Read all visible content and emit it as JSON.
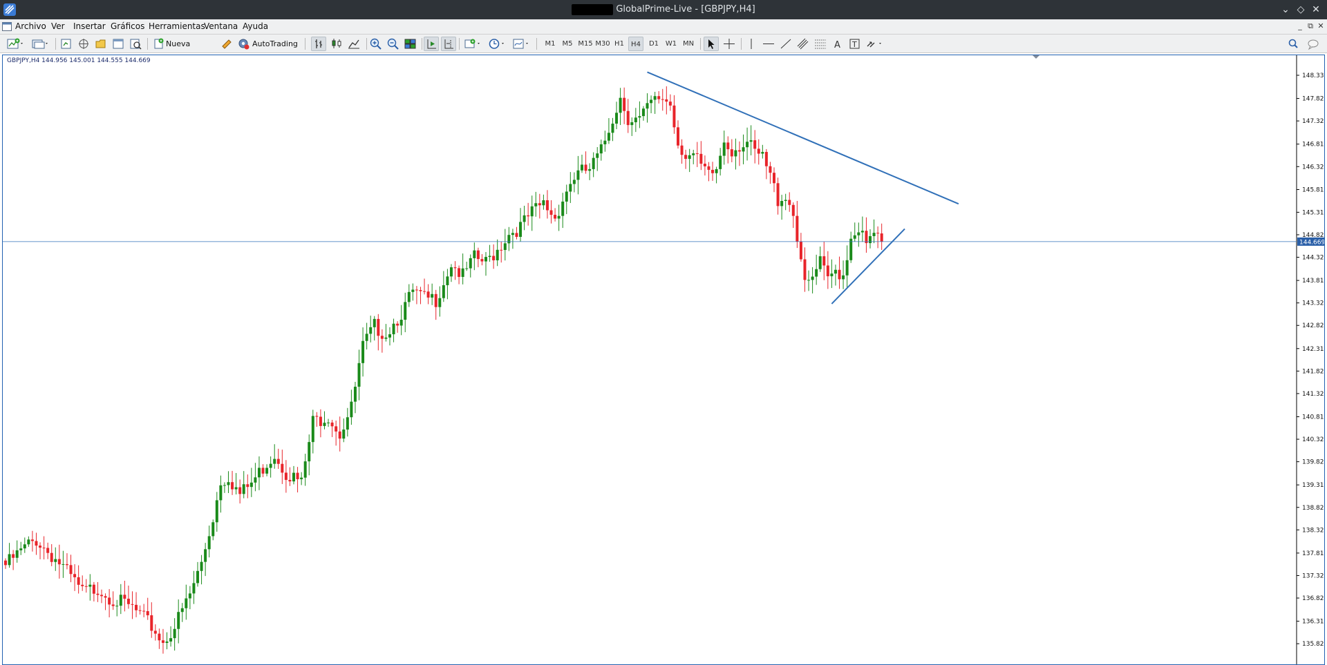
{
  "window": {
    "title": "GlobalPrime-Live - [GBPJPY,H4]",
    "controls": {
      "minimize": "⌄",
      "restore": "◇",
      "close": "✕"
    }
  },
  "menubar": {
    "items": [
      "Archivo",
      "Ver",
      "Insertar",
      "Gráficos",
      "Herramientas",
      "Ventana",
      "Ayuda"
    ],
    "mdi": {
      "minimize": "_",
      "restore": "⧉",
      "close": "✕"
    }
  },
  "toolbar": {
    "new_order_label": "Nueva orden",
    "autotrading_label": "AutoTrading",
    "timeframes": [
      "M1",
      "M5",
      "M15",
      "M30",
      "H1",
      "H4",
      "D1",
      "W1",
      "MN"
    ],
    "active_timeframe": "H4"
  },
  "chart_data": {
    "type": "candlestick",
    "symbol_info": "GBPJPY,H4  144.956 145.001 144.555 144.669",
    "last_price": "144.669",
    "price_axis": [
      "148.330",
      "147.820",
      "147.325",
      "146.815",
      "146.320",
      "145.815",
      "145.315",
      "144.820",
      "144.325",
      "143.815",
      "143.320",
      "142.825",
      "142.315",
      "141.820",
      "141.325",
      "140.815",
      "140.320",
      "139.825",
      "139.315",
      "138.820",
      "138.325",
      "137.815",
      "137.320",
      "136.825",
      "136.315",
      "135.820"
    ],
    "ylim": [
      135.45,
      148.6
    ],
    "colors": {
      "bull": "#1a8a1a",
      "bear": "#e8242a",
      "wick": "#333333",
      "trendline": "#3070b8",
      "price_line": "#3070b8",
      "price_tag_bg": "#2a5fa8"
    },
    "anchors": [
      {
        "i": 0,
        "p": 137.55
      },
      {
        "i": 6,
        "p": 138.0
      },
      {
        "i": 8,
        "p": 138.1
      },
      {
        "i": 14,
        "p": 137.6
      },
      {
        "i": 20,
        "p": 136.95
      },
      {
        "i": 24,
        "p": 137.05
      },
      {
        "i": 28,
        "p": 136.8
      },
      {
        "i": 33,
        "p": 136.6
      },
      {
        "i": 38,
        "p": 136.2
      },
      {
        "i": 41,
        "p": 135.85
      },
      {
        "i": 44,
        "p": 136.2
      },
      {
        "i": 48,
        "p": 136.9
      },
      {
        "i": 51,
        "p": 137.6
      },
      {
        "i": 54,
        "p": 138.6
      },
      {
        "i": 56,
        "p": 139.4
      },
      {
        "i": 58,
        "p": 139.5
      },
      {
        "i": 61,
        "p": 139.1
      },
      {
        "i": 64,
        "p": 139.35
      },
      {
        "i": 67,
        "p": 139.7
      },
      {
        "i": 70,
        "p": 140.0
      },
      {
        "i": 73,
        "p": 139.6
      },
      {
        "i": 77,
        "p": 139.35
      },
      {
        "i": 80,
        "p": 140.7
      },
      {
        "i": 84,
        "p": 140.85
      },
      {
        "i": 87,
        "p": 140.45
      },
      {
        "i": 90,
        "p": 141.0
      },
      {
        "i": 93,
        "p": 142.35
      },
      {
        "i": 96,
        "p": 142.8
      },
      {
        "i": 99,
        "p": 142.65
      },
      {
        "i": 103,
        "p": 143.1
      },
      {
        "i": 106,
        "p": 143.55
      },
      {
        "i": 109,
        "p": 143.4
      },
      {
        "i": 112,
        "p": 143.4
      },
      {
        "i": 116,
        "p": 144.2
      },
      {
        "i": 119,
        "p": 143.9
      },
      {
        "i": 122,
        "p": 144.3
      },
      {
        "i": 125,
        "p": 144.2
      },
      {
        "i": 128,
        "p": 144.5
      },
      {
        "i": 131,
        "p": 144.85
      },
      {
        "i": 134,
        "p": 145.0
      },
      {
        "i": 137,
        "p": 145.3
      },
      {
        "i": 140,
        "p": 145.5
      },
      {
        "i": 143,
        "p": 145.2
      },
      {
        "i": 146,
        "p": 145.8
      },
      {
        "i": 148,
        "p": 146.1
      },
      {
        "i": 150,
        "p": 146.2
      },
      {
        "i": 152,
        "p": 146.25
      },
      {
        "i": 155,
        "p": 146.65
      },
      {
        "i": 158,
        "p": 147.4
      },
      {
        "i": 160,
        "p": 147.85
      },
      {
        "i": 162,
        "p": 147.4
      },
      {
        "i": 165,
        "p": 147.35
      },
      {
        "i": 168,
        "p": 147.7
      },
      {
        "i": 171,
        "p": 147.85
      },
      {
        "i": 173,
        "p": 147.7
      },
      {
        "i": 175,
        "p": 146.85
      },
      {
        "i": 177,
        "p": 146.6
      },
      {
        "i": 179,
        "p": 146.55
      },
      {
        "i": 181,
        "p": 146.3
      },
      {
        "i": 183,
        "p": 146.1
      },
      {
        "i": 185,
        "p": 146.25
      },
      {
        "i": 187,
        "p": 146.9
      },
      {
        "i": 189,
        "p": 146.7
      },
      {
        "i": 191,
        "p": 146.8
      },
      {
        "i": 193,
        "p": 146.85
      },
      {
        "i": 195,
        "p": 146.6
      },
      {
        "i": 197,
        "p": 146.5
      },
      {
        "i": 199,
        "p": 146.1
      },
      {
        "i": 201,
        "p": 145.6
      },
      {
        "i": 203,
        "p": 145.7
      },
      {
        "i": 205,
        "p": 145.3
      },
      {
        "i": 207,
        "p": 144.3
      },
      {
        "i": 208,
        "p": 143.65
      },
      {
        "i": 210,
        "p": 143.85
      },
      {
        "i": 212,
        "p": 144.2
      },
      {
        "i": 214,
        "p": 143.8
      },
      {
        "i": 216,
        "p": 144.05
      },
      {
        "i": 218,
        "p": 143.95
      },
      {
        "i": 220,
        "p": 144.8
      },
      {
        "i": 222,
        "p": 145.0
      },
      {
        "i": 224,
        "p": 144.55
      },
      {
        "i": 226,
        "p": 144.85
      },
      {
        "i": 228,
        "p": 144.669
      }
    ],
    "trendlines": [
      {
        "name": "resistance",
        "from": {
          "i": 167,
          "p": 148.4
        },
        "to": {
          "i": 248,
          "p": 145.5
        }
      },
      {
        "name": "support",
        "from": {
          "i": 215,
          "p": 143.3
        },
        "to": {
          "i": 234,
          "p": 144.95
        }
      }
    ]
  }
}
